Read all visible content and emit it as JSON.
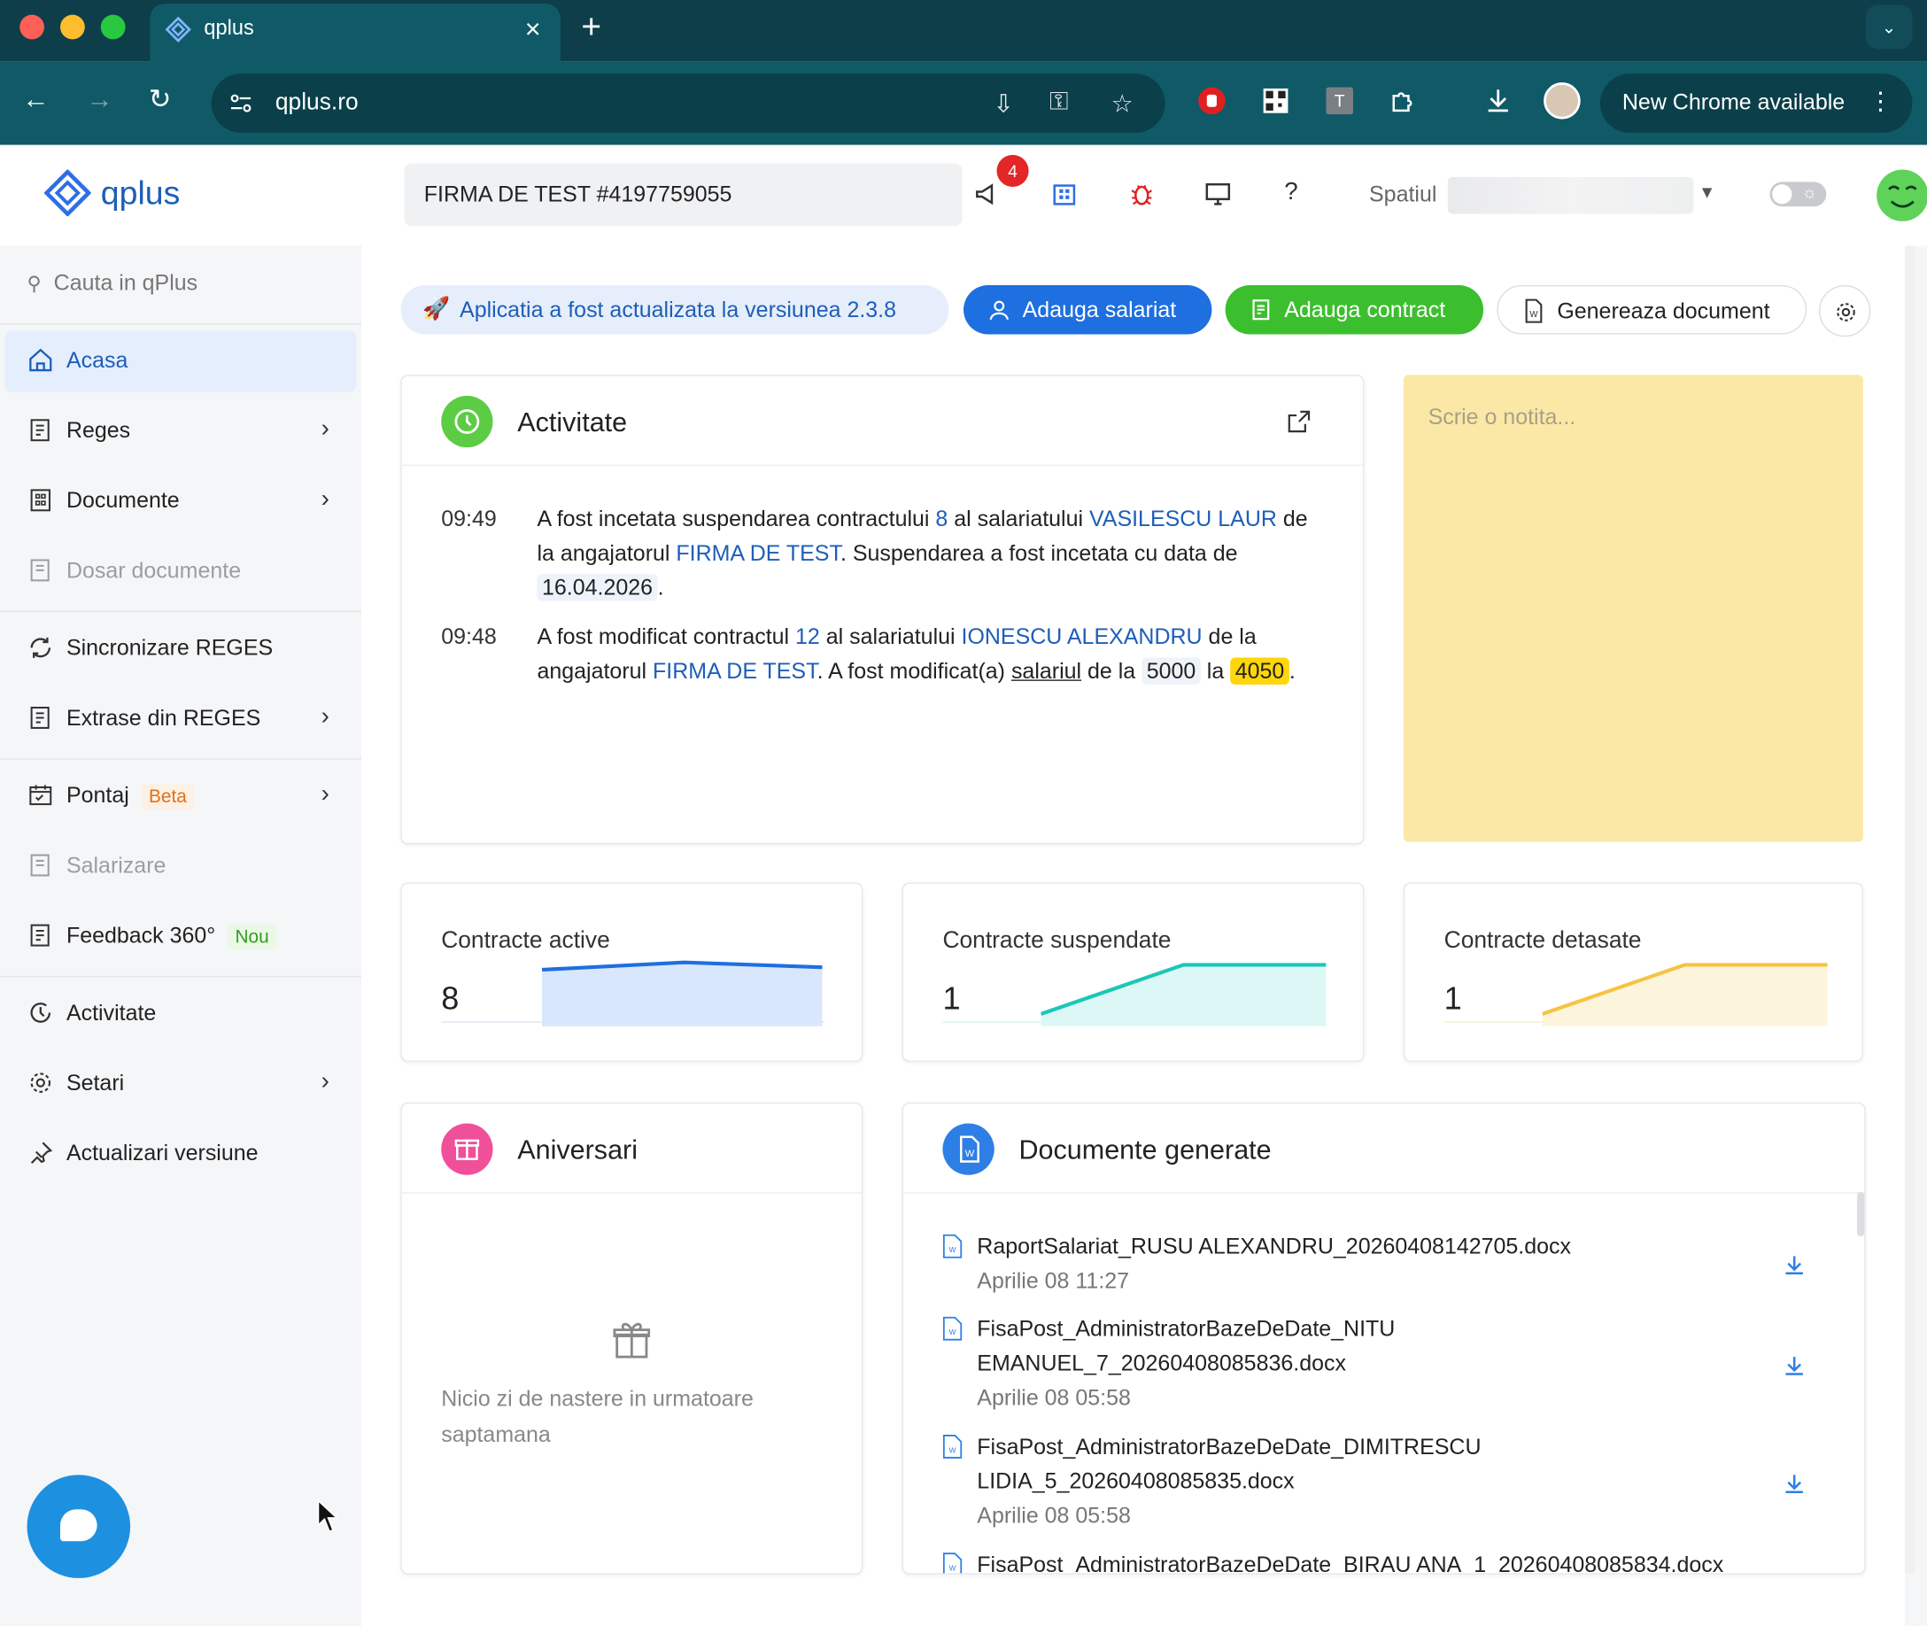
{
  "browser": {
    "tab_title": "qplus",
    "url": "qplus.ro",
    "chrome_update_label": "New Chrome available"
  },
  "header": {
    "logo_text": "qplus",
    "company": "FIRMA DE TEST #4197759055",
    "notification_count": "4",
    "space_label": "Spatiul"
  },
  "sidebar": {
    "search_placeholder": "Cauta in qPlus",
    "items": [
      {
        "label": "Acasa"
      },
      {
        "label": "Reges"
      },
      {
        "label": "Documente"
      },
      {
        "label": "Dosar documente"
      },
      {
        "label": "Sincronizare REGES"
      },
      {
        "label": "Extrase din REGES"
      },
      {
        "label": "Pontaj",
        "tag": "Beta"
      },
      {
        "label": "Salarizare"
      },
      {
        "label": "Feedback 360°",
        "tag": "Nou"
      },
      {
        "label": "Activitate"
      },
      {
        "label": "Setari"
      },
      {
        "label": "Actualizari versiune"
      }
    ]
  },
  "actions": {
    "update_info": "Aplicatia a fost actualizata la versiunea 2.3.8",
    "add_employee": "Adauga salariat",
    "add_contract": "Adauga contract",
    "generate_document": "Genereaza document"
  },
  "activity": {
    "title": "Activitate",
    "entries": [
      {
        "time": "09:49",
        "p1": "A fost incetata suspendarea contractului ",
        "contract_no": "8",
        "p2": " al salariatului ",
        "employee": "VASILESCU LAUR",
        "p3": " de la angajatorul ",
        "employer": "FIRMA DE TEST",
        "p4": ". Suspendarea a fost incetata cu data de ",
        "date": "16.04.2026",
        "p5": "."
      },
      {
        "time": "09:48",
        "p1": "A fost modificat contractul ",
        "contract_no": "12",
        "p2": " al salariatului ",
        "employee": "IONESCU ALEXANDRU",
        "p3": " de la angajatorul ",
        "employer": "FIRMA DE TEST",
        "p4": ". A fost modificat(a) ",
        "field": "salariul",
        "p5": " de la ",
        "old_value": "5000",
        "p6": " la ",
        "new_value": "4050",
        "p7": "."
      }
    ]
  },
  "note": {
    "placeholder": "Scrie o notita..."
  },
  "stats": [
    {
      "label": "Contracte active",
      "value": "8",
      "color": "#1e6fe0",
      "fill": "#d9e7fc"
    },
    {
      "label": "Contracte suspendate",
      "value": "1",
      "color": "#1cc6b8",
      "fill": "#dcf8f6"
    },
    {
      "label": "Contracte detasate",
      "value": "1",
      "color": "#f6c343",
      "fill": "#fdf5db"
    }
  ],
  "anniversaries": {
    "title": "Aniversari",
    "empty_text": "Nicio zi de nastere in urmatoare saptamana"
  },
  "documents": {
    "title": "Documente generate",
    "items": [
      {
        "name": "RaportSalariat_RUSU ALEXANDRU_20260408142705.docx",
        "date": "Aprilie 08 11:27"
      },
      {
        "name": "FisaPost_AdministratorBazeDeDate_NITU EMANUEL_7_20260408085836.docx",
        "date": "Aprilie 08 05:58"
      },
      {
        "name": "FisaPost_AdministratorBazeDeDate_DIMITRESCU LIDIA_5_20260408085835.docx",
        "date": "Aprilie 08 05:58"
      },
      {
        "name": "FisaPost_AdministratorBazeDeDate_BIRAU ANA_1_20260408085834.docx",
        "date": ""
      }
    ]
  },
  "colors": {
    "primary": "#1e6fe0",
    "success": "#3cbf2f",
    "link": "#1e5eb8",
    "browser_frame": "#0f5a66"
  }
}
